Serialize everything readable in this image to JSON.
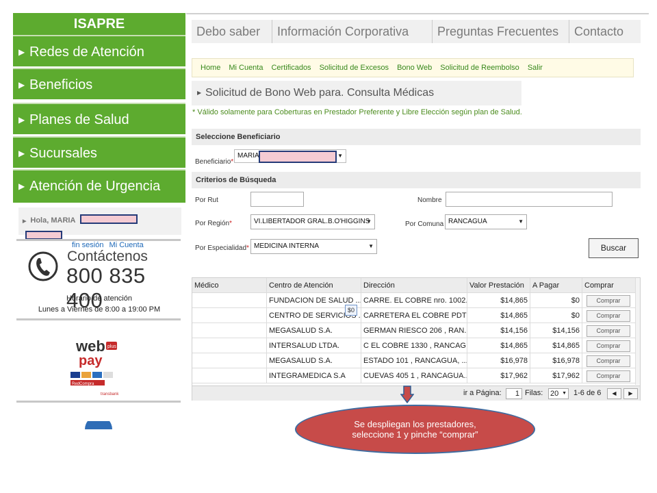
{
  "sidebar": {
    "title": "ISAPRE",
    "items": [
      {
        "label": "Redes de Atención"
      },
      {
        "label": "Beneficios"
      },
      {
        "label": "Planes de Salud"
      },
      {
        "label": "Sucursales"
      },
      {
        "label": "Atención de Urgencia"
      }
    ],
    "greeting": "Hola, MARIA",
    "logout_link": "fin sesión",
    "account_link": "Mi Cuenta",
    "contact_title": "Contáctenos",
    "contact_phone": "800 835 400",
    "hours_title": "Horario de atención",
    "hours_detail": "Lunes a Viernes de 8:00 a 19:00 PM",
    "webpay": {
      "word1": "web",
      "word2": "pay",
      "badge": "plus",
      "redcompra": "RedCompra",
      "transbank": "transbank"
    }
  },
  "topnav": [
    "Debo saber",
    "Información Corporativa",
    "Preguntas Frecuentes",
    "Contacto"
  ],
  "subnav": [
    "Home",
    "Mi Cuenta",
    "Certificados",
    "Solicitud de Excesos",
    "Bono Web",
    "Solicitud de Reembolso",
    "Salir"
  ],
  "page_title": "Solicitud de Bono Web para. Consulta Médicas",
  "note": "* Válido solamente para Coberturas en Prestador Preferente y Libre Elección según plan de Salud.",
  "beneficiary": {
    "section": "Seleccione Beneficiario",
    "label": "Beneficiario",
    "required_mark": "*",
    "value": "MARIA"
  },
  "criteria": {
    "section": "Criterios de Búsqueda",
    "rut_label": "Por Rut",
    "rut_value": "",
    "name_label": "Nombre",
    "name_value": "",
    "region_label": "Por Región",
    "region_value": "VI.LIBERTADOR GRAL.B.O'HIGGINS",
    "comuna_label": "Por Comuna",
    "comuna_value": "RANCAGUA",
    "specialty_label": "Por Especialidad",
    "specialty_value": "MEDICINA INTERNA",
    "search_button": "Buscar"
  },
  "table": {
    "headers": [
      "Médico",
      "Centro de Atención",
      "Dirección",
      "Valor Prestación",
      "A Pagar",
      "Comprar"
    ],
    "rows": [
      {
        "medico": "",
        "centro": "FUNDACION DE SALUD ...",
        "direccion": "CARRE. EL COBRE nro. 1002...",
        "valor": "$14,865",
        "pagar": "$0",
        "comprar": "Comprar"
      },
      {
        "medico": "",
        "centro": "CENTRO DE SERVICIOS ...",
        "direccion": "CARRETERA EL COBRE PDTE...",
        "valor": "$14,865",
        "pagar": "$0",
        "comprar": "Comprar"
      },
      {
        "medico": "",
        "centro": "MEGASALUD S.A.",
        "direccion": "GERMAN RIESCO 206 , RAN...",
        "valor": "$14,156",
        "pagar": "$14,156",
        "comprar": "Comprar"
      },
      {
        "medico": "",
        "centro": "INTERSALUD LTDA.",
        "direccion": "C EL COBRE 1330 , RANCAG...",
        "valor": "$14,865",
        "pagar": "$14,865",
        "comprar": "Comprar"
      },
      {
        "medico": "",
        "centro": "MEGASALUD S.A.",
        "direccion": "ESTADO 101 , RANCAGUA, ...",
        "valor": "$16,978",
        "pagar": "$16,978",
        "comprar": "Comprar"
      },
      {
        "medico": "",
        "centro": "INTEGRAMEDICA S.A",
        "direccion": "CUEVAS 405 1 , RANCAGUA...",
        "valor": "$17,962",
        "pagar": "$17,962",
        "comprar": "Comprar"
      }
    ],
    "tooltip": "$0",
    "footer": {
      "goto_label": "ir a Página:",
      "page_value": "1",
      "rows_label": "Filas:",
      "rows_value": "20",
      "range": "1-6 de 6"
    }
  },
  "callout": {
    "line1": "Se despliegan los prestadores,",
    "line2": "seleccione 1 y pinche “comprar”"
  },
  "colors": {
    "sidebar_green": "#5dab2f",
    "link_green": "#36881b",
    "callout_red": "#c74b49",
    "link_blue": "#1d68b8"
  }
}
